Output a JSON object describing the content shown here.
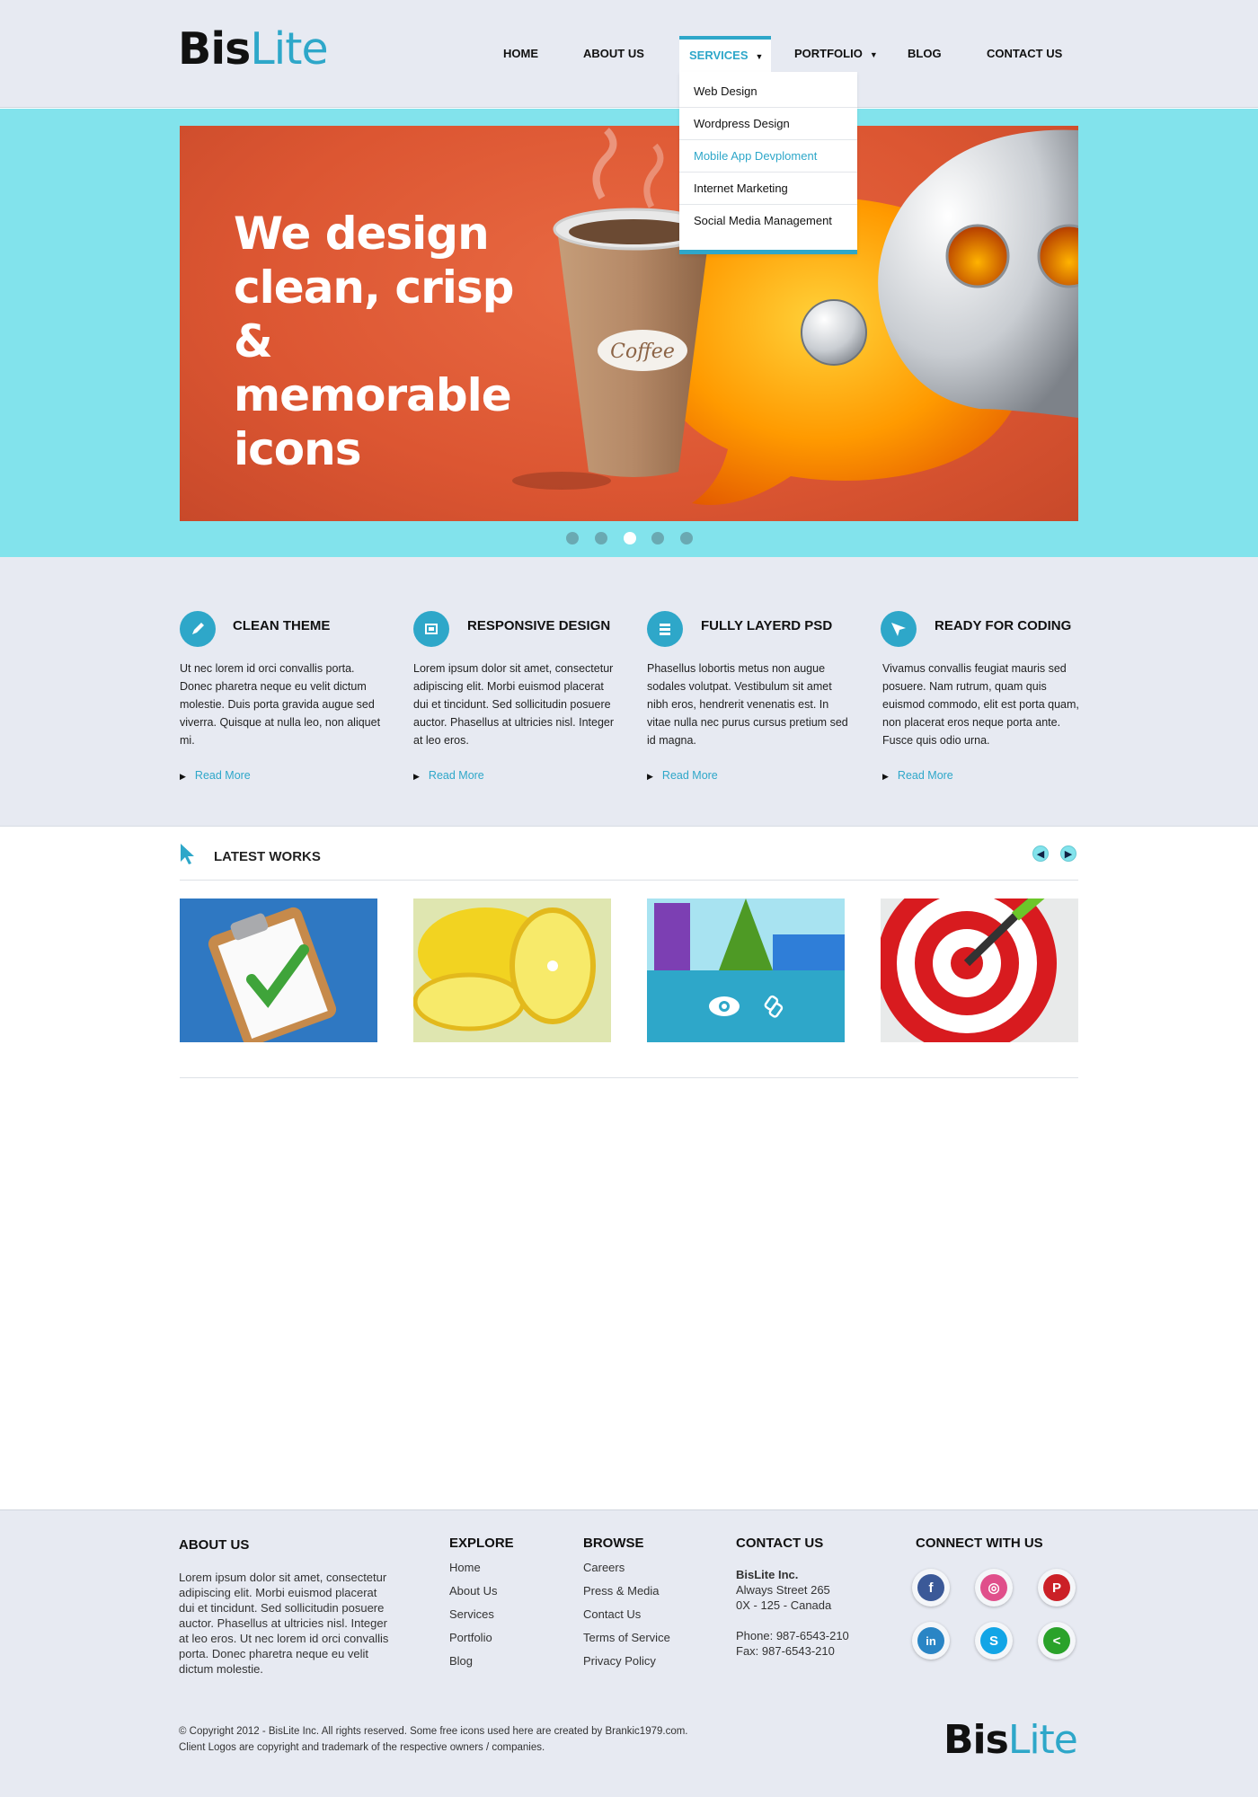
{
  "brand": {
    "bold": "Bis",
    "light": "Lite"
  },
  "nav": {
    "home": "HOME",
    "about": "ABOUT US",
    "services": "SERVICES",
    "portfolio": "PORTFOLIO",
    "blog": "BLOG",
    "contact": "CONTACT US"
  },
  "dropdown": [
    "Web Design",
    "Wordpress Design",
    "Mobile App Devploment",
    "Internet Marketing",
    "Social Media Management"
  ],
  "hero": {
    "title": "We design clean, crisp & memorable icons",
    "cup_label": "Coffee",
    "dots": 5,
    "active_dot": 3
  },
  "features": [
    {
      "title": "CLEAN THEME",
      "icon": "pencil-icon",
      "text": "Ut nec lorem id orci convallis porta. Donec pharetra neque eu velit dictum molestie. Duis porta gravida augue sed viverra. Quisque at nulla leo, non aliquet mi.",
      "link": "Read More"
    },
    {
      "title": "RESPONSIVE DESIGN",
      "icon": "responsive-icon",
      "text": "Lorem ipsum dolor sit amet, consectetur adipiscing elit. Morbi euismod placerat dui et tincidunt. Sed sollicitudin posuere auctor. Phasellus at ultricies nisl. Integer at leo eros.",
      "link": "Read More"
    },
    {
      "title": "FULLY LAYERD PSD",
      "icon": "layers-icon",
      "text": " Phasellus lobortis metus non augue sodales volutpat. Vestibulum sit amet nibh eros, hendrerit venenatis est. In vitae nulla nec purus cursus pretium sed id magna.",
      "link": "Read More"
    },
    {
      "title": "READY FOR CODING",
      "icon": "paper-plane-icon",
      "text": "Vivamus convallis feugiat mauris sed posuere. Nam rutrum, quam quis euismod commodo, elit est porta quam, non placerat eros neque porta ante. Fusce quis odio urna.",
      "link": "Read More"
    }
  ],
  "works": {
    "title": "LATEST WORKS",
    "items": [
      "clipboard-checklist-image",
      "lemon-image",
      "3d-shapes-image",
      "target-dart-image"
    ]
  },
  "footer": {
    "about": {
      "title": "ABOUT US",
      "text": "Lorem ipsum dolor sit amet, consectetur adipiscing elit. Morbi euismod placerat dui et tincidunt. Sed sollicitudin posuere auctor. Phasellus at ultricies nisl. Integer at leo eros. Ut nec lorem id orci convallis porta. Donec pharetra neque eu velit dictum molestie."
    },
    "explore": {
      "title": "EXPLORE",
      "links": [
        "Home",
        "About Us",
        "Services",
        "Portfolio",
        "Blog"
      ]
    },
    "browse": {
      "title": "BROWSE",
      "links": [
        "Careers",
        "Press & Media",
        "Contact Us",
        "Terms of Service",
        "Privacy Policy"
      ]
    },
    "contact": {
      "title": "CONTACT US",
      "company": "BisLite Inc.",
      "street": "Always Street 265",
      "city": "0X - 125 - Canada",
      "phone": "Phone: 987-6543-210",
      "fax": "Fax: 987-6543-210"
    },
    "connect": {
      "title": "CONNECT WITH US",
      "networks": [
        "facebook-icon",
        "dribbble-icon",
        "pinterest-icon",
        "linkedin-icon",
        "skype-icon",
        "share-icon"
      ]
    },
    "copyright1": "© Copyright 2012 - BisLite Inc. All rights reserved. Some free icons used here are created by Brankic1979.com.",
    "copyright2": "Client Logos are copyright and trademark of the respective owners / companies."
  },
  "colors": {
    "accent": "#2ea7c9",
    "hero_band": "#82e3ec",
    "slide_bg": "#dc5632",
    "page_bg": "#e7eaf2"
  }
}
